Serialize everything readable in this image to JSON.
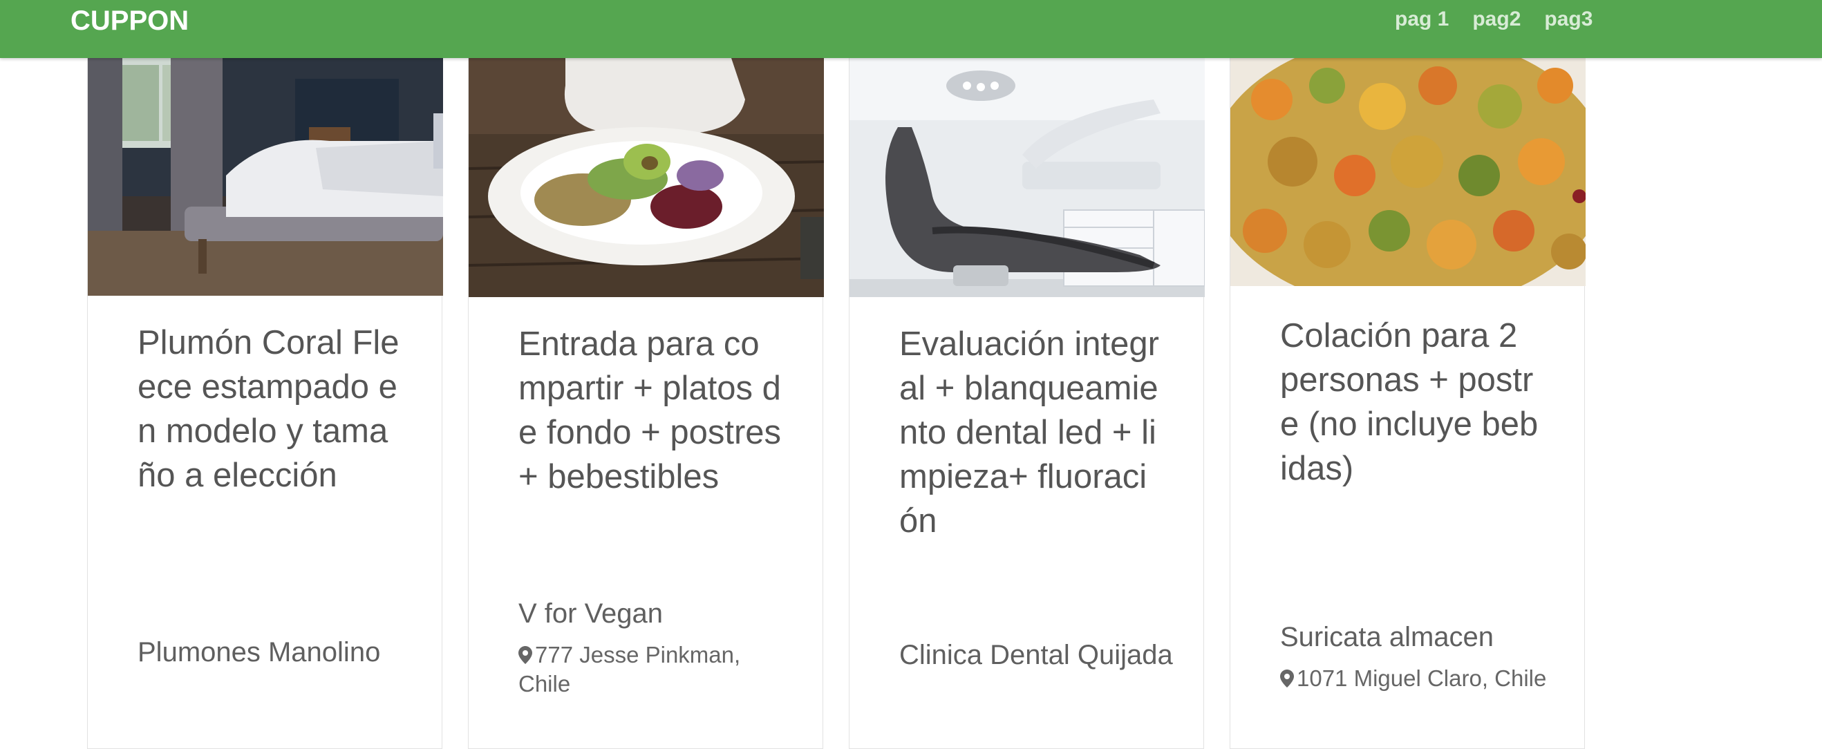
{
  "navbar": {
    "brand": "CUPPON",
    "links": [
      "pag 1",
      "pag2",
      "pag3"
    ],
    "color": "#55a650"
  },
  "cards": [
    {
      "image": "bedroom-photo",
      "title": "Plumón Coral Fleece estampado en modelo y tamaño a elección",
      "vendor": "Plumones Manolino",
      "address": ""
    },
    {
      "image": "vegan-plate-photo",
      "title": "Entrada para compartir + platos de fondo + postres + bebestibles",
      "vendor": "V for Vegan",
      "address": "777 Jesse Pinkman, Chile"
    },
    {
      "image": "dental-chair-photo",
      "title": "Evaluación integral + blanqueamiento dental led + limpieza+ fluoración",
      "vendor": "Clinica Dental Quijada",
      "address": ""
    },
    {
      "image": "vegetable-stew-photo",
      "title": "Colación para 2 personas + postre (no incluye bebidas)",
      "vendor": "Suricata almacen",
      "address": "1071 Miguel Claro, Chile"
    }
  ]
}
